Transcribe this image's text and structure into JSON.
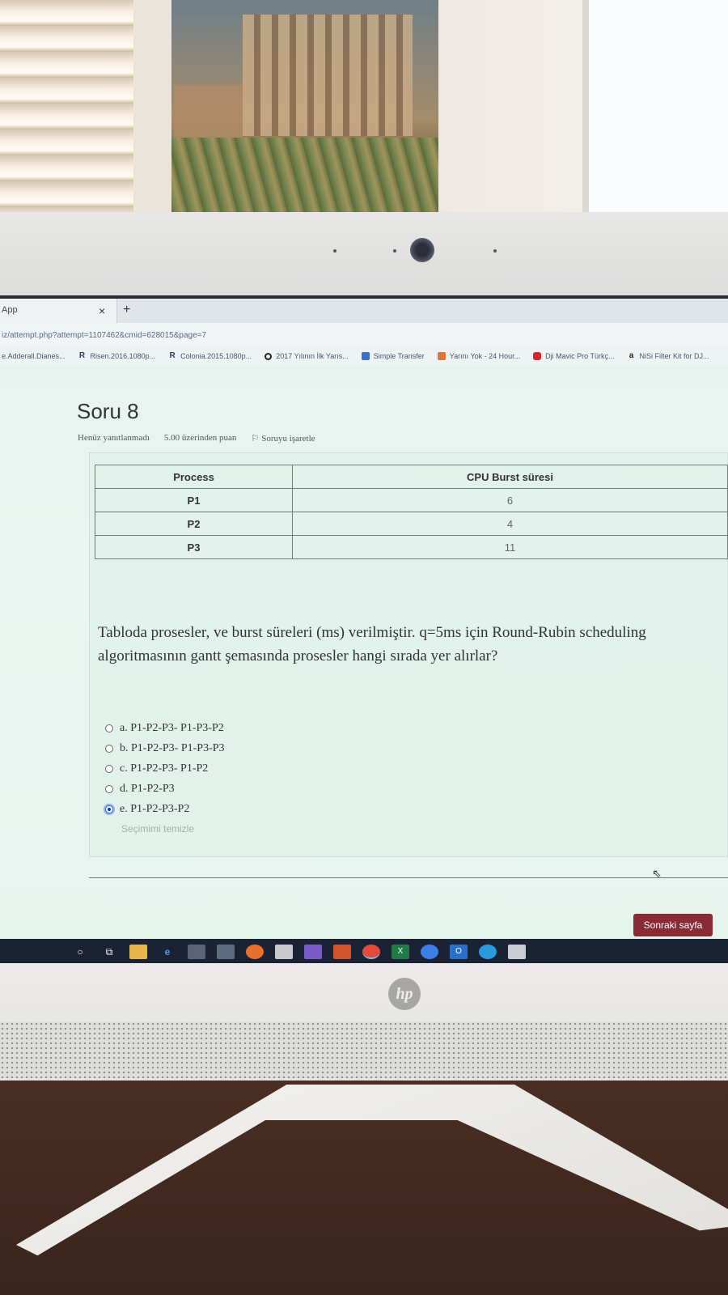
{
  "browser": {
    "tab_title": "App",
    "tab_close": "×",
    "tab_new": "+",
    "url": "iz/attempt.php?attempt=1107462&cmid=628015&page=7",
    "bookmarks": [
      {
        "label": "e.Adderall.Dianes..."
      },
      {
        "label": "Risen.2016.1080p..."
      },
      {
        "label": "Colonia.2015.1080p..."
      },
      {
        "label": "2017 Yılının İlk Yarıs..."
      },
      {
        "label": "Simple Transfer"
      },
      {
        "label": "Yarını Yok - 24 Hour..."
      },
      {
        "label": "Dji Mavic Pro Türkç..."
      },
      {
        "label": "NiSi Filter Kit for DJ..."
      }
    ]
  },
  "question": {
    "title": "Soru 8",
    "status": "Henüz yanıtlanmadı",
    "points": "5.00 üzerinden puan",
    "flag_label": "Soruyu işaretle",
    "table": {
      "headers": [
        "Process",
        "CPU Burst süresi"
      ],
      "rows": [
        {
          "process": "P1",
          "burst": "6"
        },
        {
          "process": "P2",
          "burst": "4"
        },
        {
          "process": "P3",
          "burst": "11"
        }
      ]
    },
    "text": "Tabloda prosesler, ve burst süreleri (ms) verilmiştir. q=5ms için Round-Rubin scheduling algoritmasının gantt şemasında prosesler hangi sırada yer alırlar?",
    "options": [
      {
        "label": "a. P1-P2-P3- P1-P3-P2",
        "selected": false
      },
      {
        "label": "b. P1-P2-P3- P1-P3-P3",
        "selected": false
      },
      {
        "label": "c. P1-P2-P3- P1-P2",
        "selected": false
      },
      {
        "label": "d. P1-P2-P3",
        "selected": false
      },
      {
        "label": "e. P1-P2-P3-P2",
        "selected": true
      }
    ],
    "clear_label": "Seçimimi temizle",
    "next_label": "Sonraki sayfa"
  },
  "taskbar": {
    "icons": [
      "start-search-icon",
      "task-view-icon",
      "file-explorer-icon",
      "edge-legacy-icon",
      "photos-icon",
      "calculator-icon",
      "firefox-icon",
      "store-icon",
      "visual-studio-icon",
      "media-player-icon",
      "chrome-icon",
      "excel-icon",
      "zoom-icon",
      "outlook-icon",
      "edge-icon",
      "app-icon"
    ]
  },
  "device": {
    "brand": "hp"
  },
  "colors": {
    "next_button": "#8a2a35",
    "page_background": "#e8f2ef",
    "taskbar": "#1a2233"
  }
}
